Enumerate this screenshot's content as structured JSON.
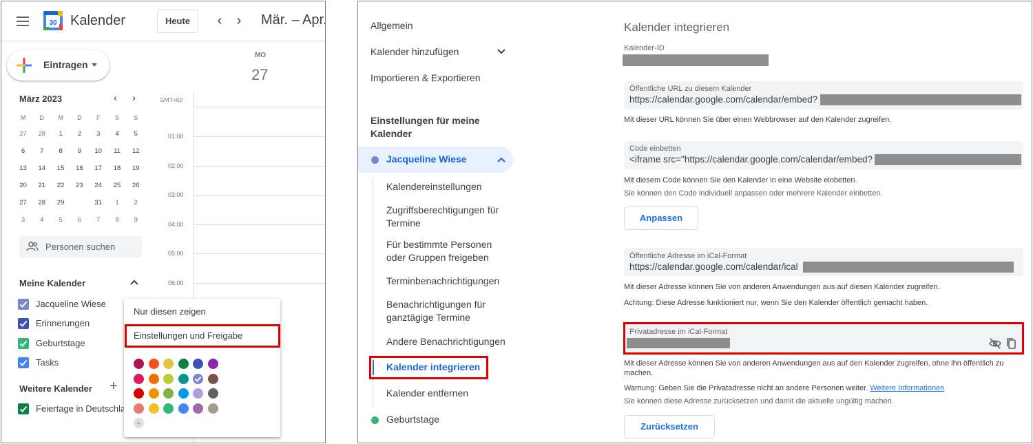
{
  "left": {
    "app_title": "Kalender",
    "logo_number": "30",
    "today_button": "Heute",
    "date_range": "Mär. – Apr.",
    "create_button": "Eintragen",
    "mini_calendar": {
      "month_label": "März 2023",
      "weekdays": [
        "M",
        "D",
        "M",
        "D",
        "F",
        "S",
        "S"
      ],
      "weeks": [
        [
          "27",
          "28",
          "1",
          "2",
          "3",
          "4",
          "5"
        ],
        [
          "6",
          "7",
          "8",
          "9",
          "10",
          "11",
          "12"
        ],
        [
          "13",
          "14",
          "15",
          "16",
          "17",
          "18",
          "19"
        ],
        [
          "20",
          "21",
          "22",
          "23",
          "24",
          "25",
          "26"
        ],
        [
          "27",
          "28",
          "29",
          "30",
          "31",
          "1",
          "2"
        ],
        [
          "3",
          "4",
          "5",
          "6",
          "7",
          "8",
          "9"
        ]
      ],
      "today": "30"
    },
    "search_people": "Personen suchen",
    "my_calendars_title": "Meine Kalender",
    "my_calendars": [
      {
        "name": "Jacqueline Wiese",
        "color": "#7986cb"
      },
      {
        "name": "Erinnerungen",
        "color": "#3f51b5"
      },
      {
        "name": "Geburtstage",
        "color": "#33b679"
      },
      {
        "name": "Tasks",
        "color": "#4285f4"
      }
    ],
    "other_calendars_title": "Weitere Kalender",
    "other_calendars": [
      {
        "name": "Feiertage in Deutschland",
        "color": "#0b8043"
      }
    ],
    "day_header": {
      "weekday": "MO",
      "day": "27"
    },
    "timezone": "GMT+02",
    "hours": [
      "01:00",
      "02:00",
      "03:00",
      "04:00",
      "05:00",
      "06:00"
    ],
    "popup": {
      "item_only_this": "Nur diesen zeigen",
      "item_settings": "Einstellungen und Freigabe",
      "colors": [
        [
          "#ad1457",
          "#f4511e",
          "#e4c441",
          "#0b8043",
          "#3f51b5",
          "#8e24aa"
        ],
        [
          "#d81b60",
          "#ef6c00",
          "#c0ca33",
          "#009688",
          "#7986cb",
          "#795548"
        ],
        [
          "#d50000",
          "#f09300",
          "#7cb342",
          "#039be5",
          "#b39ddb",
          "#616161"
        ],
        [
          "#e67c73",
          "#f6bf26",
          "#33b679",
          "#4285f4",
          "#9e69af",
          "#a79b8e"
        ]
      ]
    }
  },
  "right": {
    "nav": {
      "general": "Allgemein",
      "add_calendar": "Kalender hinzufügen",
      "import_export": "Importieren & Exportieren",
      "my_settings_title_line1": "Einstellungen für meine",
      "my_settings_title_line2": "Kalender",
      "active_calendar": "Jacqueline Wiese",
      "active_calendar_color": "#7986cb",
      "sub_items": [
        [
          "Kalendereinstellungen"
        ],
        [
          "Zugriffsberechtigungen für",
          "Termine"
        ],
        [
          "Für bestimmte Personen",
          "oder Gruppen freigeben"
        ],
        [
          "Terminbenachrichtigungen"
        ],
        [
          "Benachrichtigungen für",
          "ganztägige Termine"
        ],
        [
          "Andere Benachrichtigungen"
        ]
      ],
      "integrate": "Kalender integrieren",
      "remove": "Kalender entfernen",
      "birthdays": "Geburtstage",
      "birthdays_color": "#33b679"
    },
    "content": {
      "heading": "Kalender integrieren",
      "calendar_id_label": "Kalender-ID",
      "public_url_label": "Öffentliche URL zu diesem Kalender",
      "public_url_value": "https://calendar.google.com/calendar/embed?",
      "public_url_help": "Mit dieser URL können Sie über einen Webbrowser auf den Kalender zugreifen.",
      "embed_label": "Code einbetten",
      "embed_value": "<iframe src=\"https://calendar.google.com/calendar/embed?",
      "embed_help_1": "Mit diesem Code können Sie den Kalender in eine Website einbetten.",
      "embed_help_2": "Sie können den Code individuell anpassen oder mehrere Kalender einbetten.",
      "customize_button": "Anpassen",
      "ical_public_label": "Öffentliche Adresse im iCal-Format",
      "ical_public_value": "https://calendar.google.com/calendar/ical",
      "ical_public_help_1": "Mit dieser Adresse können Sie von anderen Anwendungen aus auf diesen Kalender zugreifen.",
      "ical_public_help_2": "Achtung: Diese Adresse funktioniert nur, wenn Sie den Kalender öffentlich gemacht haben.",
      "ical_private_label": "Privatadresse im iCal-Format",
      "ical_private_help_line1": "Mit dieser Adresse können Sie von anderen Anwendungen aus auf den Kalender zugreifen, ohne ihn öffentlich zu",
      "ical_private_help_line2": "machen.",
      "warning_text": "Warnung: Geben Sie die Privatadresse nicht an andere Personen weiter.",
      "more_info_link": "Weitere Informationen",
      "reset_help": "Sie können diese Adresse zurücksetzen und damit die aktuelle ungültig machen.",
      "reset_button": "Zurücksetzen"
    }
  }
}
